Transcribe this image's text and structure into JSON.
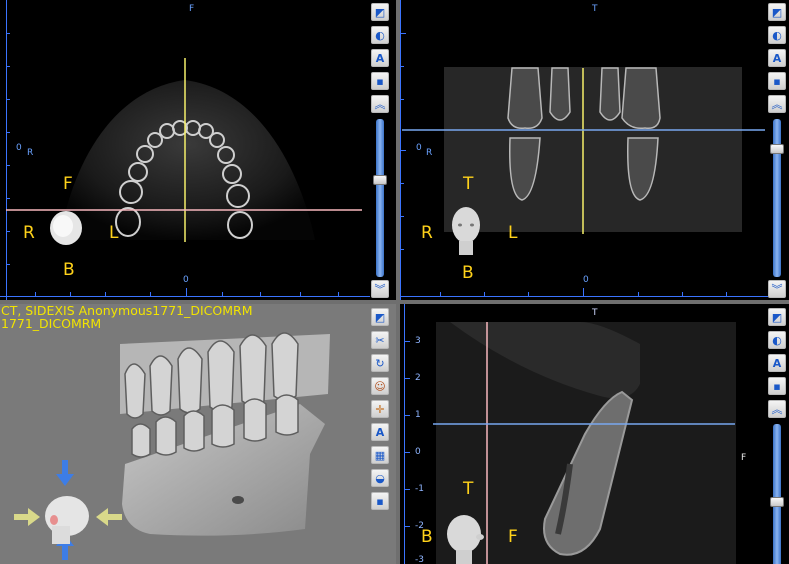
{
  "axial": {
    "top_label": "F",
    "origin_label": "0",
    "r_label": "R",
    "bottom_zero": "0",
    "orient": {
      "top": "F",
      "left": "R",
      "right": "L",
      "bottom": "B"
    }
  },
  "coronal": {
    "top_label": "T",
    "origin_label": "0",
    "r_label": "R",
    "bottom_zero": "0",
    "orient": {
      "top": "T",
      "left": "R",
      "right": "L",
      "bottom": "B"
    }
  },
  "volume3d": {
    "info_line1": "CT, SIDEXIS Anonymous1771_DICOMRM",
    "info_line2": "1771_DICOMRM"
  },
  "sagittal": {
    "top_label": "T",
    "right_label": "F",
    "ruler": [
      "3",
      "2",
      "1",
      "0",
      "-1",
      "-2",
      "-3"
    ],
    "orient": {
      "top": "T",
      "left": "B",
      "right": "F"
    }
  },
  "toolbars": {
    "axial": [
      "view-mode-icon",
      "slice-icon",
      "annotation-a-icon",
      "camera-icon",
      "scroll-up-icon",
      "scroll-down-icon"
    ],
    "coronal": [
      "view-mode-icon",
      "slice-icon",
      "annotation-a-icon",
      "camera-icon",
      "scroll-up-icon",
      "scroll-down-icon"
    ],
    "volume": [
      "view-mode-icon",
      "cut-tool-icon",
      "rotate-icon",
      "face-icon",
      "crosshair-icon",
      "annotation-a-icon",
      "grid-icon",
      "bone-icon",
      "camera-icon"
    ],
    "sagittal": [
      "view-mode-icon",
      "slice-icon",
      "annotation-a-icon",
      "camera-icon",
      "scroll-up-icon"
    ]
  },
  "colors": {
    "crosshair_yellow": "#f5ef6a",
    "crosshair_pink": "#f7b7be",
    "crosshair_blue": "#78a7ef",
    "orient_text": "#ffd21a",
    "ruler_blue": "#3b74ff"
  }
}
